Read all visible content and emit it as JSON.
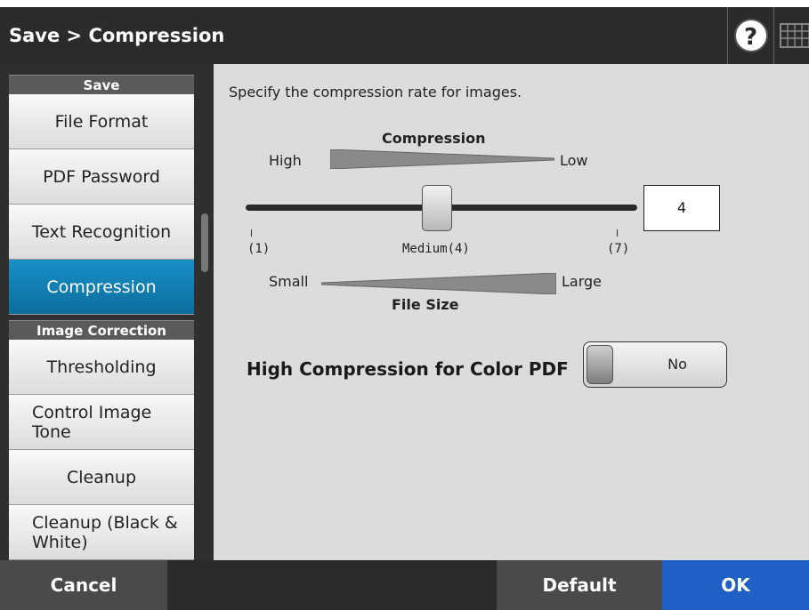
{
  "header": {
    "title": "Save > Compression",
    "help_label": "?"
  },
  "sidebar": {
    "sections": [
      "Save",
      "Image Correction"
    ],
    "items": [
      {
        "label": "File Format"
      },
      {
        "label": "PDF Password"
      },
      {
        "label": "Text Recognition"
      },
      {
        "label": "Compression",
        "active": true
      },
      {
        "label": "Thresholding"
      },
      {
        "label": "Control Image Tone"
      },
      {
        "label": "Cleanup"
      },
      {
        "label": "Cleanup (Black & White)"
      }
    ]
  },
  "main": {
    "instruction": "Specify the compression rate for images.",
    "compression_title": "Compression",
    "high": "High",
    "low": "Low",
    "scale": {
      "min_label": "(1)",
      "mid_label": "Medium(4)",
      "max_label": "(7)",
      "value": "4",
      "min": 1,
      "max": 7
    },
    "small": "Small",
    "large": "Large",
    "file_size_title": "File Size",
    "high_compression_label": "High Compression for Color PDF",
    "high_compression_value": "No"
  },
  "footer": {
    "cancel": "Cancel",
    "default": "Default",
    "ok": "OK"
  },
  "colors": {
    "active_item": "#1a8fc6",
    "ok_button": "#1e60c4",
    "header_bg": "#2b2b2b"
  },
  "icons": [
    "help-icon",
    "keyboard-icon"
  ]
}
